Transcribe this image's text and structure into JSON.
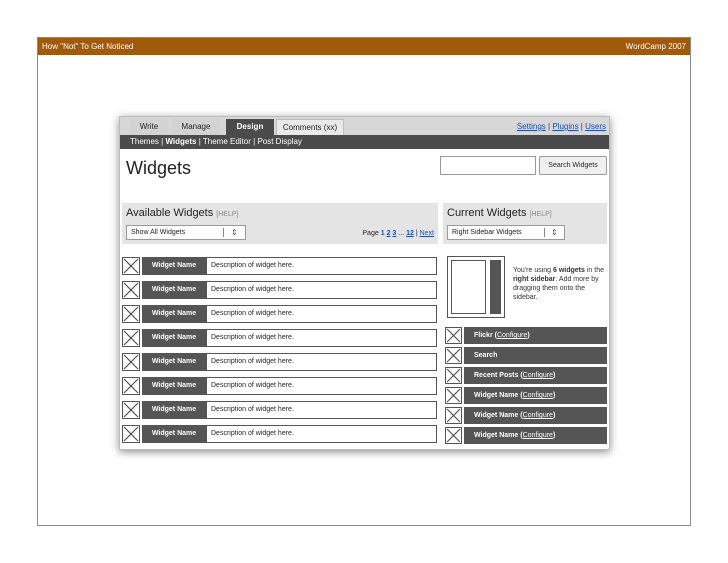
{
  "slide": {
    "title": "How \"Not\" To Get Noticed",
    "event": "WordCamp 2007"
  },
  "tabs": {
    "write": "Write",
    "manage": "Manage",
    "design": "Design",
    "comments": "Comments (xx)"
  },
  "top_links": {
    "settings": "Settings",
    "sep1": " | ",
    "plugins": "Plugins",
    "sep2": " | ",
    "users": "Users"
  },
  "subnav": {
    "themes": "Themes",
    "sep1": " | ",
    "widgets": "Widgets",
    "sep2": " | ",
    "theme_editor": "Theme Editor",
    "sep3": " | ",
    "post_display": "Post Display"
  },
  "page": {
    "title": "Widgets",
    "search_value": "",
    "search_button": "Search Widgets"
  },
  "available": {
    "title": "Available Widgets",
    "help": "[HELP]",
    "filter": "Show All Widgets",
    "pager_label": "Page",
    "page_1": "1",
    "page_2": "2",
    "page_3": "3",
    "ellipsis": "...",
    "page_last": "12",
    "pager_sep": " | ",
    "next": "Next",
    "widgets": [
      {
        "name": "Widget Name",
        "desc": "Description of widget here."
      },
      {
        "name": "Widget Name",
        "desc": "Description of widget here."
      },
      {
        "name": "Widget Name",
        "desc": "Description of widget here."
      },
      {
        "name": "Widget Name",
        "desc": "Description of widget here."
      },
      {
        "name": "Widget Name",
        "desc": "Description of widget here."
      },
      {
        "name": "Widget Name",
        "desc": "Description of widget here."
      },
      {
        "name": "Widget Name",
        "desc": "Description of widget here."
      },
      {
        "name": "Widget Name",
        "desc": "Description of widget here."
      }
    ]
  },
  "current": {
    "title": "Current Widgets",
    "help": "[HELP]",
    "sidebar_select": "Right Sidebar Widgets",
    "note_1": "You're using ",
    "note_count": "6 widgets",
    "note_2": " in the ",
    "note_sidebar": "right sidebar",
    "note_3": ". Add more by dragging them onto the sidebar.",
    "configure": "Configure",
    "widgets": [
      {
        "name": "Flickr",
        "configurable": true
      },
      {
        "name": "Search",
        "configurable": false
      },
      {
        "name": "Recent Posts",
        "configurable": true
      },
      {
        "name": "Widget Name",
        "configurable": true
      },
      {
        "name": "Widget Name",
        "configurable": true
      },
      {
        "name": "Widget Name",
        "configurable": true
      }
    ]
  }
}
